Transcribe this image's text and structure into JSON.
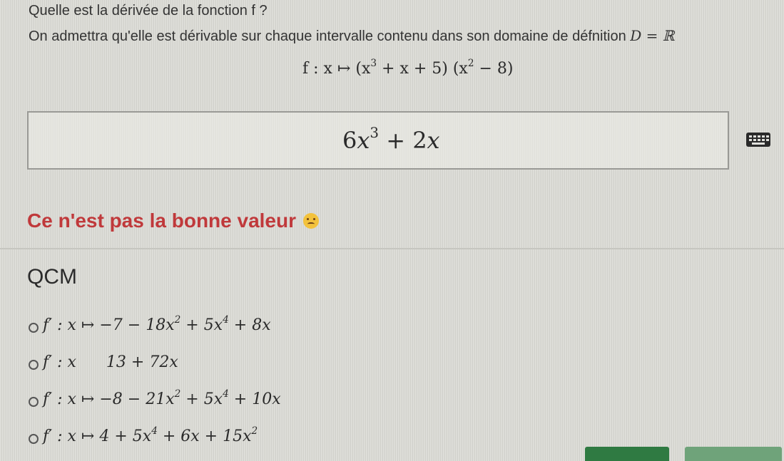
{
  "question": {
    "title": "Quelle est la dérivée de la fonction f ?",
    "subtitle_text": "On admettra qu'elle est dérivable sur chaque intervalle contenu dans son domaine de défnition",
    "domain": "D = ℝ"
  },
  "function_def": {
    "prefix": "f : x ↦ (x",
    "exp1": "3",
    "middle": " + x + 5) (x",
    "exp2": "2",
    "suffix": " − 8)"
  },
  "answer_input": {
    "coef": "6",
    "var": "x",
    "exp": "3",
    "rest": " + 2",
    "var2": "x"
  },
  "keyboard_icon": "keyboard-icon",
  "feedback": {
    "text": "Ce n'est pas la bonne valeur",
    "emoji": "sad-face-icon",
    "color": "#c0393b"
  },
  "qcm": {
    "title": "QCM",
    "options": [
      {
        "p1": "f′ : x ↦ −7 − 18x",
        "e1": "2",
        "p2": " + 5x",
        "e2": "4",
        "p3": " + 8x",
        "e3": "",
        "p4": ""
      },
      {
        "p1": "f′ : x",
        "e1": "",
        "p2": "      13 + 72x",
        "e2": "",
        "p3": "",
        "e3": "",
        "p4": ""
      },
      {
        "p1": "f′ : x ↦ −8 − 21x",
        "e1": "2",
        "p2": " + 5x",
        "e2": "4",
        "p3": " + 10x",
        "e3": "",
        "p4": ""
      },
      {
        "p1": "f′ : x ↦ 4 + 5x",
        "e1": "4",
        "p2": " + 6x + 15x",
        "e2": "2",
        "p3": "",
        "e3": "",
        "p4": ""
      }
    ]
  },
  "colors": {
    "primary_button": "#2f7a42",
    "secondary_button": "#6fa37a"
  }
}
